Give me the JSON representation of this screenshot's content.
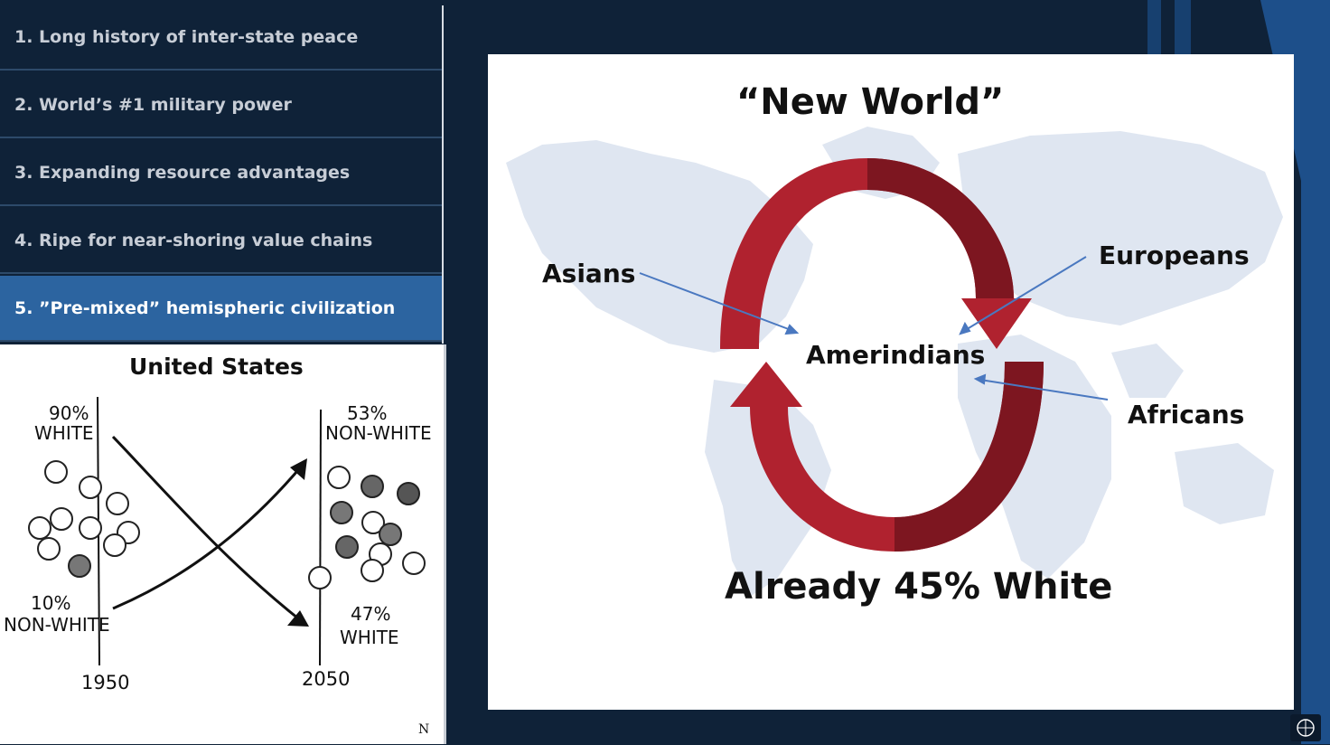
{
  "menu": {
    "items": [
      {
        "label": "1. Long history of inter-state peace",
        "active": false
      },
      {
        "label": "2. World’s #1 military power",
        "active": false
      },
      {
        "label": "3. Expanding resource advantages",
        "active": false
      },
      {
        "label": "4. Ripe for near-shoring value chains",
        "active": false
      },
      {
        "label": "5. ”Pre-mixed” hemispheric civilization",
        "active": true
      }
    ]
  },
  "comic": {
    "title": "United States",
    "left_top_pct": "90%",
    "left_top_label": "WHITE",
    "left_bottom_pct": "10%",
    "left_bottom_label": "NON-WHITE",
    "right_top_pct": "53%",
    "right_top_label": "NON-WHITE",
    "right_bottom_pct": "47%",
    "right_bottom_label": "WHITE",
    "year_start": "1950",
    "year_end": "2050",
    "signature": "N"
  },
  "diagram": {
    "title": "“New World”",
    "center_label": "Amerindians",
    "left_label": "Asians",
    "right_top_label": "Europeans",
    "right_bottom_label": "Africans",
    "footer": "Already 45% White",
    "arrow_color": "#b0222f",
    "arrow_dark_color": "#7d1620",
    "pointer_color": "#4a78c0",
    "map_color": "#dfe6f1"
  },
  "colors": {
    "background": "#0f2238",
    "active_menu": "#2c64a0",
    "stripe": "#1d4f8a"
  }
}
